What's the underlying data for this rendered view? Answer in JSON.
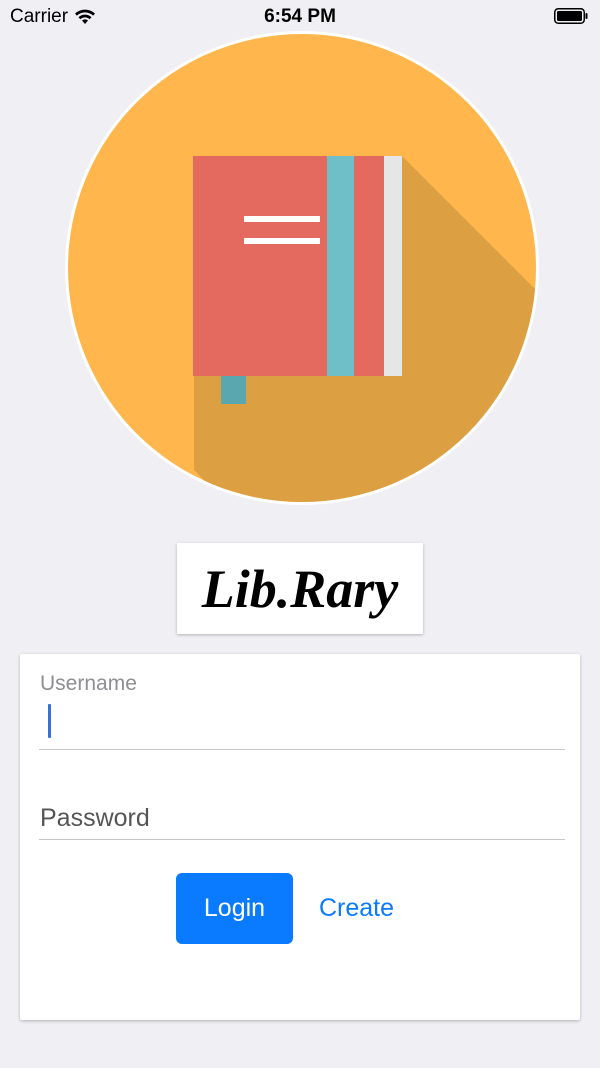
{
  "status_bar": {
    "carrier": "Carrier",
    "time": "6:54 PM"
  },
  "logo": {
    "icon": "book-icon",
    "circle_color": "#ffb74d",
    "shadow_color": "#dca042",
    "book_color": "#e46a5f",
    "stripe_color": "#6ebfc7"
  },
  "app": {
    "title": "Lib.Rary"
  },
  "login": {
    "username_label": "Username",
    "password_label": "Password",
    "login_label": "Login",
    "create_label": "Create"
  },
  "colors": {
    "accent": "#0a7aff",
    "background": "#efeff4"
  }
}
